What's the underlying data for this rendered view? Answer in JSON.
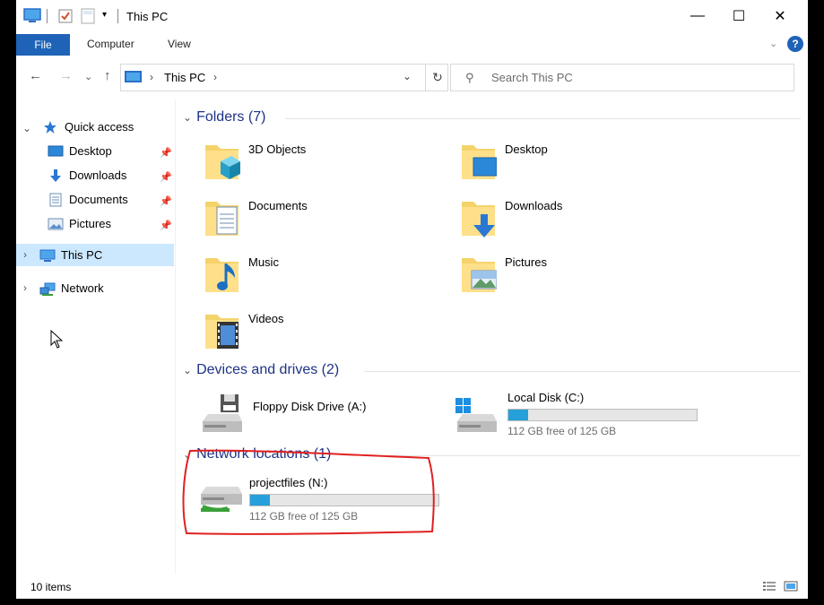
{
  "window": {
    "title": "This PC",
    "accent": "#1e63b7"
  },
  "titlebar": {
    "icons": [
      "this-pc-icon",
      "properties-icon",
      "new-folder-icon",
      "customize-dropdown-icon"
    ],
    "minimize": "—",
    "maximize": "☐",
    "close": "✕"
  },
  "ribbon": {
    "tabs": [
      "File",
      "Computer",
      "View"
    ],
    "help": "?",
    "collapse": "⌄"
  },
  "navbar": {
    "back": "←",
    "forward": "→",
    "recent": "⌄",
    "up": "↑",
    "path": "This PC",
    "path_sep": "›",
    "dropdown": "⌄",
    "refresh": "↻"
  },
  "search": {
    "placeholder": "Search This PC"
  },
  "navpane": {
    "quick_access": "Quick access",
    "quick_items": [
      "Desktop",
      "Downloads",
      "Documents",
      "Pictures"
    ],
    "this_pc": "This PC",
    "network": "Network"
  },
  "content": {
    "folders_header": "Folders (7)",
    "folders": [
      "3D Objects",
      "Desktop",
      "Documents",
      "Downloads",
      "Music",
      "Pictures",
      "Videos"
    ],
    "devices_header": "Devices and drives (2)",
    "drives": [
      {
        "label": "Floppy Disk Drive (A:)"
      },
      {
        "label": "Local Disk (C:)",
        "free": "112 GB free of 125 GB",
        "used_fraction": 0.104
      }
    ],
    "network_header": "Network locations (1)",
    "network_drives": [
      {
        "label": "projectfiles (N:)",
        "free": "112 GB free of 125 GB",
        "used_fraction": 0.104
      }
    ]
  },
  "status": {
    "items": "10 items"
  },
  "annotation_color": "#e02020"
}
